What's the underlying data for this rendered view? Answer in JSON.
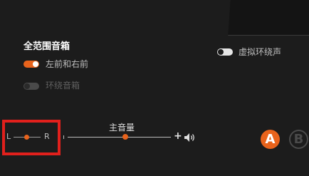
{
  "speaker_section": {
    "title": "全范围音箱",
    "options": [
      {
        "label": "左前和右前",
        "enabled": true
      },
      {
        "label": "环绕音箱",
        "enabled": false
      }
    ]
  },
  "virtual_surround": {
    "label": "虚拟环绕声",
    "enabled": false
  },
  "balance": {
    "left_label": "L",
    "right_label": "R",
    "value": 0.5
  },
  "volume": {
    "title": "主音量",
    "plus_label": "+",
    "value": 0.55
  },
  "presets": {
    "a_label": "A",
    "b_label": "B"
  },
  "colors": {
    "accent": "#e8631c",
    "highlight_box": "#e1201c"
  },
  "icons": {
    "speaker": "speaker-volume-icon"
  }
}
